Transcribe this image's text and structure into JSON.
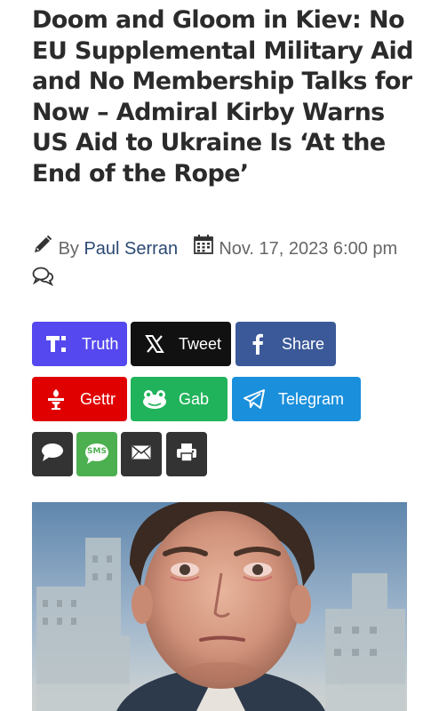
{
  "article": {
    "headline": "Doom and Gloom in Kiev: No EU Supplemental Military Aid and No Membership Talks for Now – Admiral Kirby Warns US Aid to Ukraine Is ‘At the End of the Rope’",
    "by_label": "By",
    "author": "Paul Serran",
    "date": "Nov. 17, 2023 6:00 pm"
  },
  "share": {
    "truth": "Truth",
    "tweet": "Tweet",
    "share": "Share",
    "gettr": "Gettr",
    "gab": "Gab",
    "telegram": "Telegram",
    "sms_label": "SMS"
  },
  "colors": {
    "truth": "#5448ee",
    "tweet": "#111111",
    "facebook": "#3b5998",
    "gettr": "#e00000",
    "gab": "#21b35b",
    "telegram": "#1a8fdc",
    "comment": "#333333",
    "sms": "#4caf50",
    "email": "#333333",
    "print": "#333333"
  },
  "icons": [
    "pencil-icon",
    "calendar-icon",
    "comments-icon",
    "truth-social-icon",
    "x-icon",
    "facebook-icon",
    "gettr-icon",
    "gab-frog-icon",
    "telegram-icon",
    "speech-bubble-icon",
    "sms-icon",
    "envelope-icon",
    "printer-icon"
  ]
}
